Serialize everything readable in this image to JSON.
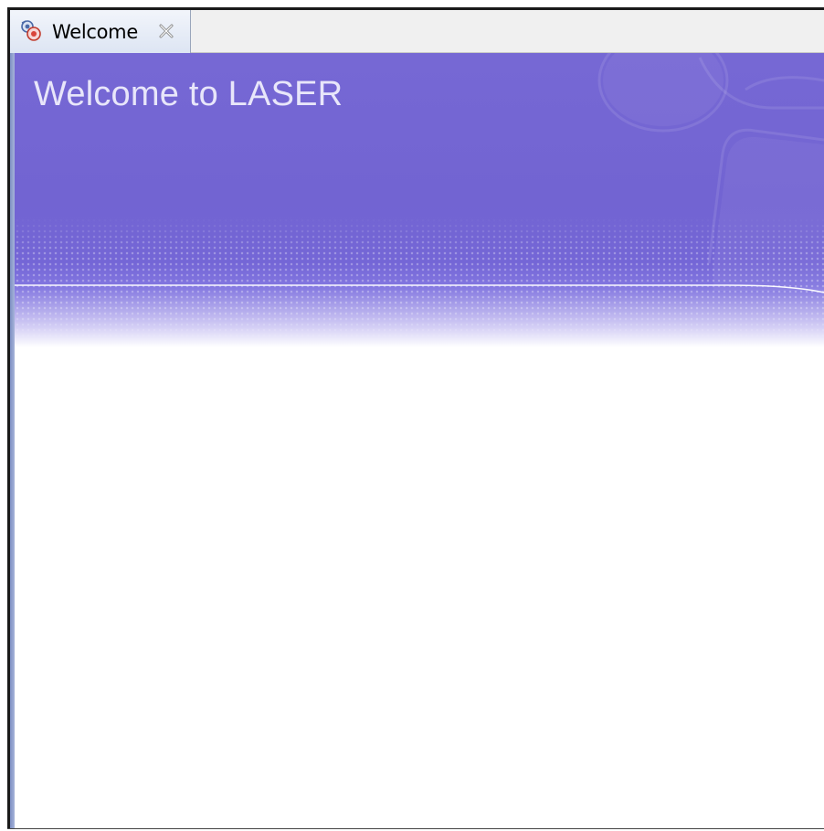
{
  "editor": {
    "tabs": [
      {
        "label": "Welcome",
        "icon": "laser-app-icon",
        "close_icon": "close-icon",
        "active": true
      }
    ]
  },
  "welcome": {
    "title": "Welcome to LASER"
  },
  "colors": {
    "banner": "#7466d6",
    "title_text": "#e8e6fa",
    "tab_bg": "#dde5f3",
    "tabstrip_bg": "#f0f0f0"
  }
}
